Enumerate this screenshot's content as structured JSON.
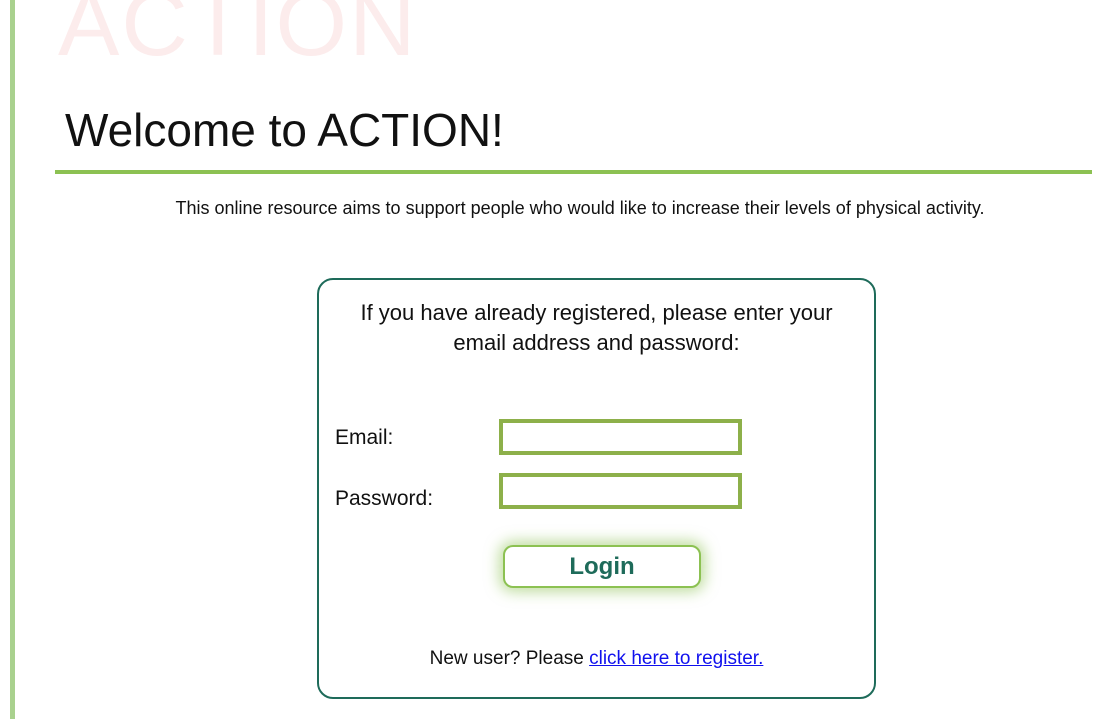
{
  "watermark": "ACTION",
  "page": {
    "title": "Welcome to ACTION!",
    "intro": "This online resource aims to support people who would like to increase their levels of physical activity."
  },
  "login": {
    "instructions": "If you have already registered, please enter your email address and password:",
    "email_label": "Email:",
    "email_value": "",
    "password_label": "Password:",
    "password_value": "",
    "button_label": "Login",
    "new_user_text": "New user? Please ",
    "register_link_text": "click here to register."
  },
  "colors": {
    "accent_green": "#8cc152",
    "field_border": "#8db04a",
    "box_border": "#1e6b5a",
    "button_text": "#1e6b5a",
    "link": "#1010ee",
    "watermark": "#fcecec"
  }
}
